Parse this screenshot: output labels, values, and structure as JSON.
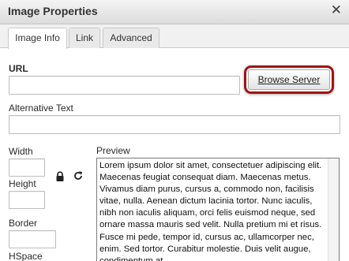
{
  "dialog": {
    "title": "Image Properties",
    "close_icon": "close-icon"
  },
  "tabs": [
    {
      "label": "Image Info",
      "active": true
    },
    {
      "label": "Link",
      "active": false
    },
    {
      "label": "Advanced",
      "active": false
    }
  ],
  "form": {
    "url_label": "URL",
    "url_value": "",
    "browse_button": "Browse Server",
    "alt_label": "Alternative Text",
    "alt_value": "",
    "width_label": "Width",
    "width_value": "",
    "height_label": "Height",
    "height_value": "",
    "border_label": "Border",
    "border_value": "",
    "hspace_label": "HSpace",
    "lock_icon": "lock-icon",
    "reset_icon": "refresh-icon"
  },
  "preview": {
    "label": "Preview",
    "text": "Lorem ipsum dolor sit amet, consectetuer adipiscing elit. Maecenas feugiat consequat diam. Maecenas metus. Vivamus diam purus, cursus a, commodo non, facilisis vitae, nulla. Aenean dictum lacinia tortor. Nunc iaculis, nibh non iaculis aliquam, orci felis euismod neque, sed ornare massa mauris sed velit. Nulla pretium mi et risus. Fusce mi pede, tempor id, cursus ac, ullamcorper nec, enim. Sed tortor. Curabitur molestie. Duis velit augue, condimentum at,"
  },
  "colors": {
    "highlight": "#9e1515",
    "dialog_background": "#ffffff",
    "titlebar_background": "#e3e3e3"
  }
}
